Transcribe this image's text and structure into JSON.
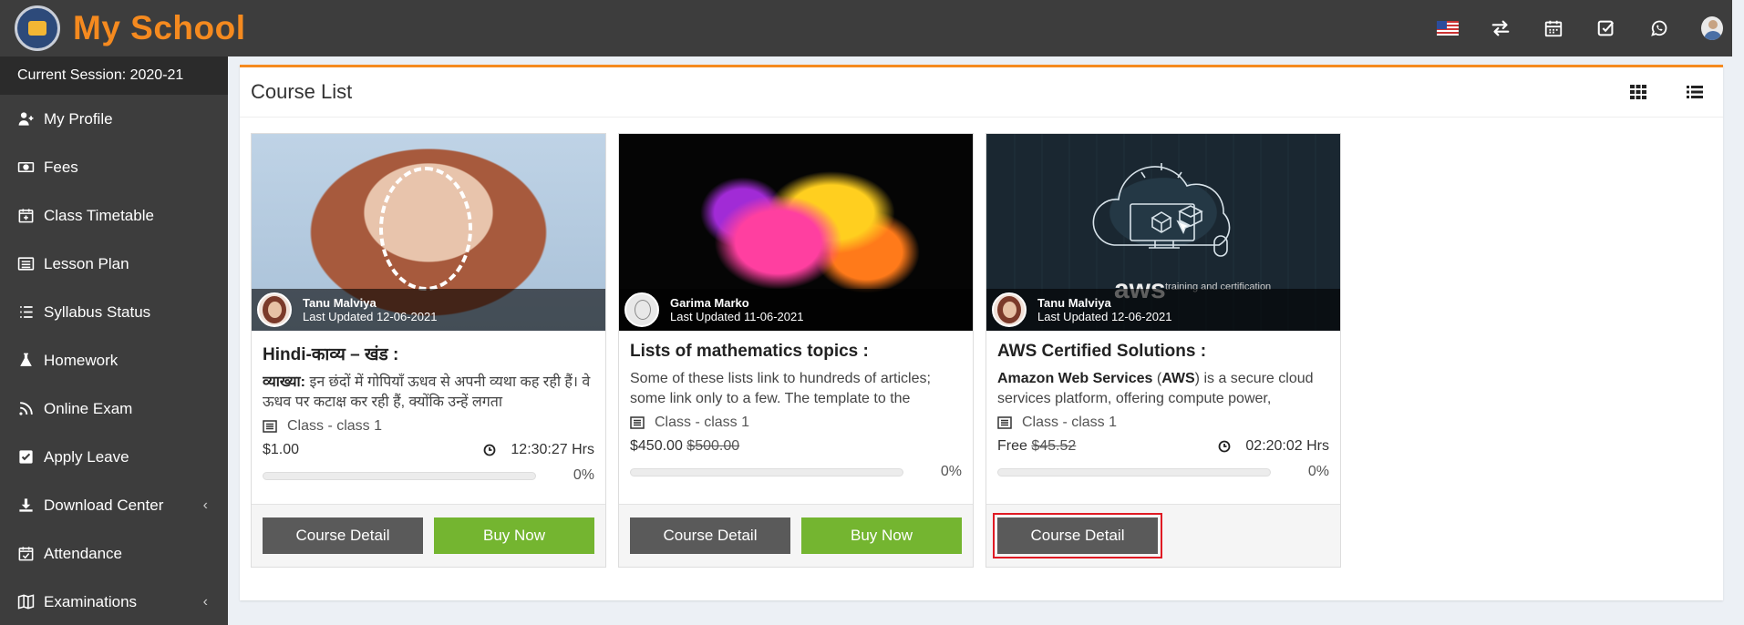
{
  "app": {
    "title": "My School"
  },
  "colors": {
    "accent": "#f58a1f",
    "sidebar": "#3d3d3d",
    "buy": "#74b530",
    "detail": "#5a5a5a"
  },
  "topbar": {
    "icons": [
      "us-flag-icon",
      "switch-icon",
      "calendar-icon",
      "check-square-icon",
      "whatsapp-icon",
      "user-avatar"
    ]
  },
  "sidebar": {
    "session": "Current Session: 2020-21",
    "items": [
      {
        "label": "My Profile",
        "icon": "user-plus-icon"
      },
      {
        "label": "Fees",
        "icon": "money-icon"
      },
      {
        "label": "Class Timetable",
        "icon": "calendar-plus-icon"
      },
      {
        "label": "Lesson Plan",
        "icon": "list-alt-icon"
      },
      {
        "label": "Syllabus Status",
        "icon": "list-icon"
      },
      {
        "label": "Homework",
        "icon": "flask-icon"
      },
      {
        "label": "Online Exam",
        "icon": "rss-icon"
      },
      {
        "label": "Apply Leave",
        "icon": "check-square-icon"
      },
      {
        "label": "Download Center",
        "icon": "download-icon",
        "chevron": "‹"
      },
      {
        "label": "Attendance",
        "icon": "calendar-check-icon"
      },
      {
        "label": "Examinations",
        "icon": "map-icon",
        "chevron": "‹"
      }
    ]
  },
  "main": {
    "title": "Course List",
    "courses": [
      {
        "author": "Tanu Malviya",
        "updated": "Last Updated 12-06-2021",
        "title": "Hindi-काव्य – खंड :",
        "desc_bold": "व्याख्या:",
        "desc": " इन छंदों में गोपियाँ ऊधव से अपनी व्यथा कह रही हैं। वे ऊधव पर कटाक्ष कर रही हैं, क्योंकि उन्हें लगता",
        "class": "Class - class 1",
        "price": "$1.00",
        "old_price": "",
        "duration": "12:30:27 Hrs",
        "progress": "0%",
        "detail_label": "Course Detail",
        "buy_label": "Buy Now"
      },
      {
        "author": "Garima Marko",
        "updated": "Last Updated 11-06-2021",
        "title": "Lists of mathematics topics :",
        "desc": "Some of these lists link to hundreds of articles; some link only to a few. The template to the",
        "class": "Class - class 1",
        "price": "$450.00",
        "old_price": "$500.00",
        "progress": "0%",
        "detail_label": "Course Detail",
        "buy_label": "Buy Now"
      },
      {
        "author": "Tanu Malviya",
        "updated": "Last Updated 12-06-2021",
        "title": "AWS Certified Solutions :",
        "desc_bold": "Amazon Web Services",
        "desc_mid": " (",
        "desc_bold2": "AWS",
        "desc": ") is a secure cloud services platform, offering compute power,",
        "class": "Class - class 1",
        "price": "Free",
        "old_price": "$45.52",
        "duration": "02:20:02 Hrs",
        "progress": "0%",
        "detail_label": "Course Detail",
        "image_text": "aws",
        "image_subtext": "training and certification"
      }
    ]
  }
}
